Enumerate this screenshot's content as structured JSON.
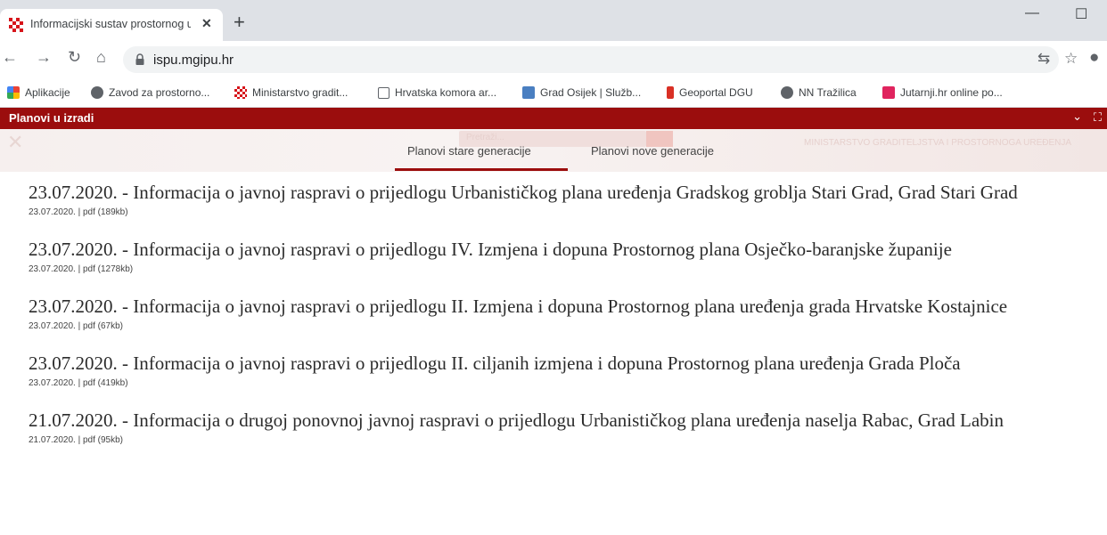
{
  "browser": {
    "tab_title": "Informacijski sustav prostornog u",
    "url": "ispu.mgipu.hr",
    "bookmarks": [
      {
        "label": "Aplikacije",
        "color": "#e94235"
      },
      {
        "label": "Zavod za prostorno...",
        "color": "#5f6368"
      },
      {
        "label": "Ministarstvo gradit...",
        "color": "#d93025"
      },
      {
        "label": "Hrvatska komora ar...",
        "color": "#5f6368"
      },
      {
        "label": "Grad Osijek | Služb...",
        "color": "#4a7fc1"
      },
      {
        "label": "Geoportal DGU",
        "color": "#d93025"
      },
      {
        "label": "NN Tražilica",
        "color": "#5f6368"
      },
      {
        "label": "Jutarnji.hr online po...",
        "color": "#e0245e"
      }
    ]
  },
  "site": {
    "bar_label": "Planovi u izradi",
    "search_placeholder": "Pretraži...",
    "ministry_text": "MINISTARSTVO GRADITELJSTVA I PROSTORNOGA UREĐENJA",
    "tabs": [
      {
        "label": "Planovi stare generacije",
        "active": true
      },
      {
        "label": "Planovi nove generacije",
        "active": false
      }
    ],
    "accent": "#9b0d0d"
  },
  "items": [
    {
      "title": "23.07.2020. - Informacija o javnoj raspravi o prijedlogu Urbanističkog plana uređenja Gradskog groblja Stari Grad, Grad Stari Grad",
      "date": "23.07.2020.",
      "file": "pdf (189kb)"
    },
    {
      "title": "23.07.2020. - Informacija o javnoj raspravi o prijedlogu IV. Izmjena i dopuna Prostornog plana Osječko-baranjske županije",
      "date": "23.07.2020.",
      "file": "pdf (1278kb)"
    },
    {
      "title": "23.07.2020. - Informacija o javnoj raspravi o prijedlogu II. Izmjena i dopuna Prostornog plana uređenja grada Hrvatske Kostajnice",
      "date": "23.07.2020.",
      "file": "pdf (67kb)"
    },
    {
      "title": "23.07.2020. - Informacija o javnoj raspravi o prijedlogu II. ciljanih izmjena i dopuna Prostornog plana uređenja Grada Ploča",
      "date": "23.07.2020.",
      "file": "pdf (419kb)"
    },
    {
      "title": "21.07.2020. - Informacija o drugoj ponovnoj javnoj raspravi o prijedlogu Urbanističkog plana uređenja naselja Rabac, Grad Labin",
      "date": "21.07.2020.",
      "file": "pdf (95kb)"
    }
  ]
}
